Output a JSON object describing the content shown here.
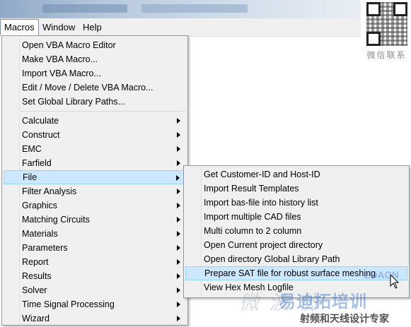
{
  "menubar": {
    "items": [
      {
        "id": "macros",
        "label": "Macros"
      },
      {
        "id": "window",
        "label": "Window"
      },
      {
        "id": "help",
        "label": "Help"
      }
    ]
  },
  "macros_menu": {
    "group1": [
      "Open VBA Macro Editor",
      "Make VBA Macro...",
      "Import VBA Macro...",
      "Edit / Move / Delete VBA Macro...",
      "Set Global Library Paths..."
    ],
    "group2": [
      "Calculate",
      "Construct",
      "EMC",
      "Farfield",
      "File",
      "Filter Analysis",
      "Graphics",
      "Matching Circuits",
      "Materials",
      "Parameters",
      "Report",
      "Results",
      "Solver",
      "Time Signal Processing",
      "Wizard"
    ],
    "highlighted": "File"
  },
  "file_submenu": {
    "items": [
      "Get Customer-ID and Host-ID",
      "Import Result Templates",
      "Import bas-file into history list",
      "Import multiple CAD files",
      "Multi column to 2 column",
      "Open Current project directory",
      "Open directory Global Library Path",
      "Prepare SAT file for robust surface meshing",
      "View Hex Mesh Logfile"
    ],
    "highlighted": "Prepare SAT file for robust surface meshing"
  },
  "watermark": {
    "cn_faded": "微波仿",
    "cn_brand": "易迪拓培训",
    "cn_tagline": "射频和天线设计专家",
    "edac": "EDACN"
  },
  "qr": {
    "caption": "微信联系"
  },
  "colors": {
    "highlight_bg": "#cce8ff",
    "highlight_border": "#99d1ff",
    "menu_bg": "#f0f0f0"
  }
}
